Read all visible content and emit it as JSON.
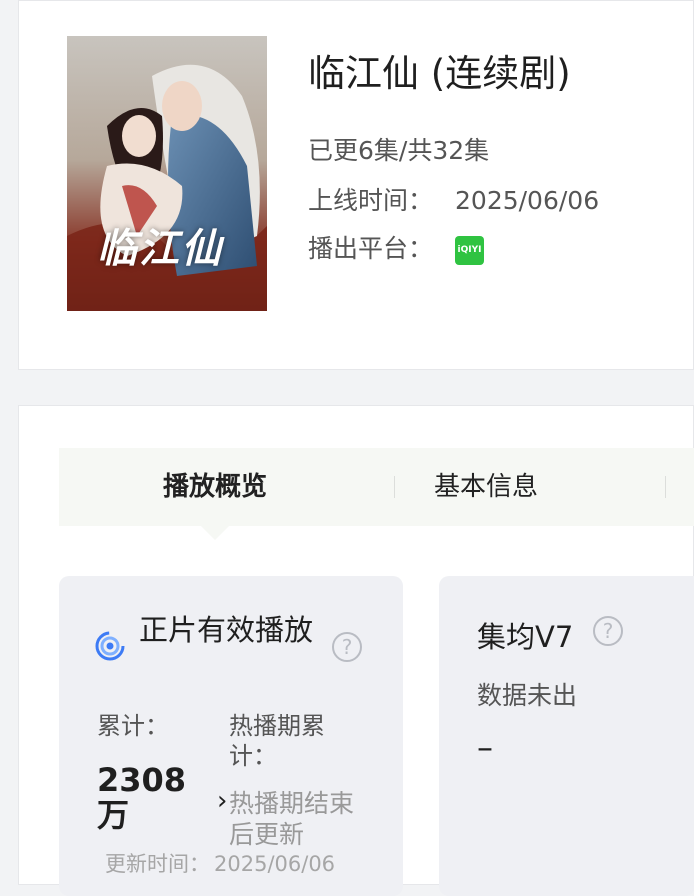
{
  "show": {
    "title": "临江仙 (连续剧)",
    "poster_calligraphy": "临江仙",
    "episodes": "已更6集/共32集",
    "release_label": "上线时间：",
    "release_date": "2025/06/06",
    "platform_label": "播出平台：",
    "platform_logo_text": "iQIYI",
    "platform_color": "#2fc341"
  },
  "tabs": [
    {
      "label": "播放概览",
      "active": true
    },
    {
      "label": "基本信息",
      "active": false
    }
  ],
  "stats": {
    "card1": {
      "title": "正片有效播放",
      "help": "?",
      "total_label": "累计：",
      "total_value": "2308万",
      "hot_label": "热播期累计：",
      "hot_value": "热播期结束后更新",
      "chevron": "›",
      "update_label": "更新时间：",
      "update_value": "2025/06/06"
    },
    "card2": {
      "title": "集均V7",
      "help": "?",
      "status": "数据未出",
      "value": "–"
    }
  },
  "colors": {
    "page_bg": "#f2f3f5",
    "card_bg": "#ffffff",
    "tab_bg": "#f6f8f4",
    "stat_card_bg": "#eff0f4",
    "muted_text": "#a6a6a6",
    "icon_blue": "#3d7bf5"
  }
}
